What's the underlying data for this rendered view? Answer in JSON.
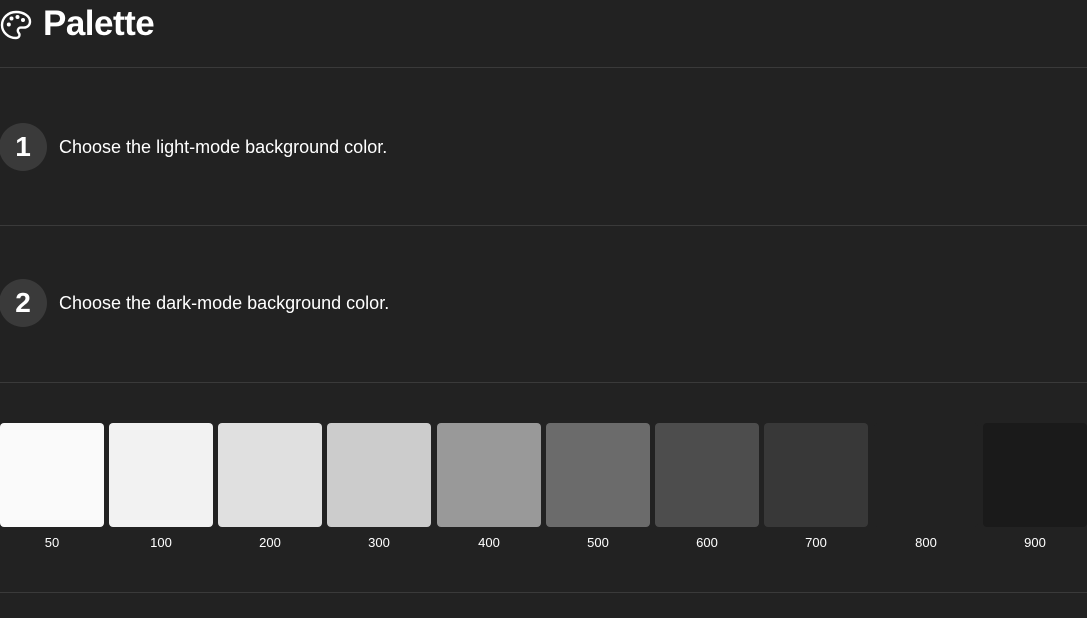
{
  "header": {
    "title": "Palette",
    "icon": "palette-icon"
  },
  "steps": [
    {
      "number": "1",
      "text": "Choose the light-mode background color."
    },
    {
      "number": "2",
      "text": "Choose the dark-mode background color."
    }
  ],
  "swatches": [
    {
      "label": "50",
      "color": "#fafafa"
    },
    {
      "label": "100",
      "color": "#f2f2f2"
    },
    {
      "label": "200",
      "color": "#e0e0e0"
    },
    {
      "label": "300",
      "color": "#cccccc"
    },
    {
      "label": "400",
      "color": "#999999"
    },
    {
      "label": "500",
      "color": "#6b6b6b"
    },
    {
      "label": "600",
      "color": "#4d4d4d"
    },
    {
      "label": "700",
      "color": "#383838"
    },
    {
      "label": "800",
      "color": "#222222"
    },
    {
      "label": "900",
      "color": "#1a1a1a"
    }
  ]
}
